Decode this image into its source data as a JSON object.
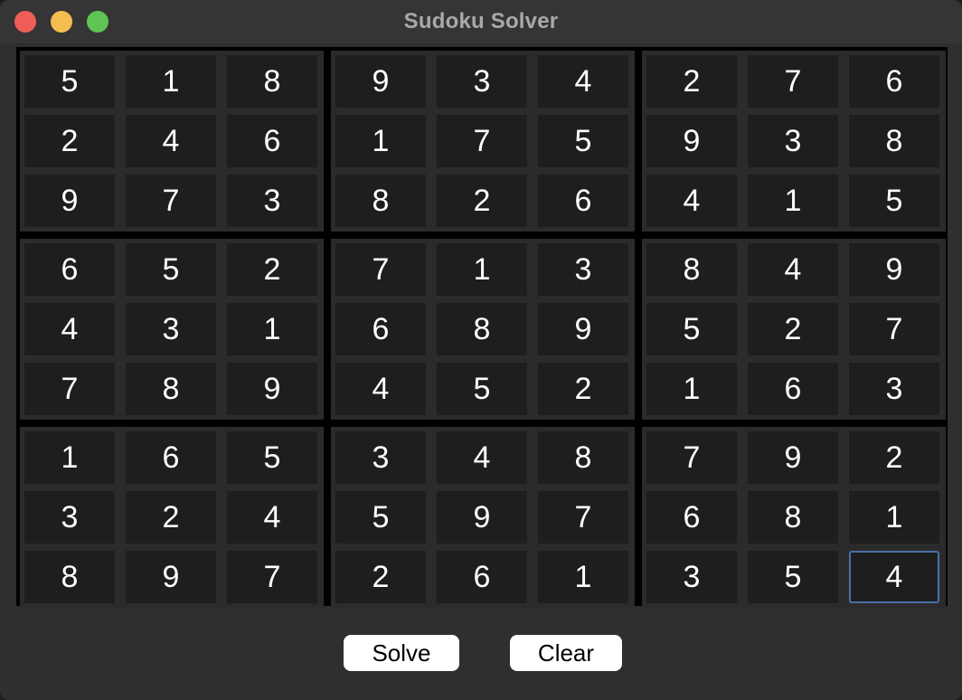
{
  "window": {
    "title": "Sudoku Solver"
  },
  "grid": [
    [
      "5",
      "1",
      "8",
      "9",
      "3",
      "4",
      "2",
      "7",
      "6"
    ],
    [
      "2",
      "4",
      "6",
      "1",
      "7",
      "5",
      "9",
      "3",
      "8"
    ],
    [
      "9",
      "7",
      "3",
      "8",
      "2",
      "6",
      "4",
      "1",
      "5"
    ],
    [
      "6",
      "5",
      "2",
      "7",
      "1",
      "3",
      "8",
      "4",
      "9"
    ],
    [
      "4",
      "3",
      "1",
      "6",
      "8",
      "9",
      "5",
      "2",
      "7"
    ],
    [
      "7",
      "8",
      "9",
      "4",
      "5",
      "2",
      "1",
      "6",
      "3"
    ],
    [
      "1",
      "6",
      "5",
      "3",
      "4",
      "8",
      "7",
      "9",
      "2"
    ],
    [
      "3",
      "2",
      "4",
      "5",
      "9",
      "7",
      "6",
      "8",
      "1"
    ],
    [
      "8",
      "9",
      "7",
      "2",
      "6",
      "1",
      "3",
      "5",
      "4"
    ]
  ],
  "focused_cell": {
    "row": 8,
    "col": 8
  },
  "buttons": {
    "solve_label": "Solve",
    "clear_label": "Clear"
  },
  "colors": {
    "focus_border": "#4a6fa8",
    "cell_background": "#1e1e1e"
  }
}
